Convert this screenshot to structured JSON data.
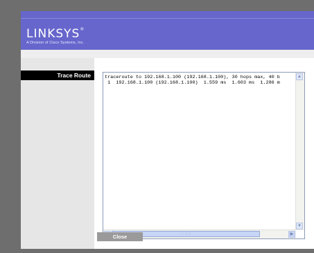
{
  "brand": {
    "logo_text": "LINKSYS",
    "trademark": "®",
    "tagline": "A Division of Cisco Systems, Inc."
  },
  "nav": {
    "section_label": "Trace Route"
  },
  "trace": {
    "output_lines": [
      "traceroute to 192.168.1.100 (192.168.1.100), 30 hops max, 40 b",
      " 1  192.168.1.100 (192.168.1.100)  1.559 ms  1.603 ms  1.286 m"
    ]
  },
  "scrollbar": {
    "up_arrow": "▲",
    "down_arrow": "▼",
    "left_arrow": "◀",
    "right_arrow": "▶",
    "grip": "⋮⋮⋮"
  },
  "actions": {
    "close_label": "Close"
  },
  "colors": {
    "header": "#6666cc",
    "nav_header": "#000000",
    "button": "#9a9a9a"
  }
}
